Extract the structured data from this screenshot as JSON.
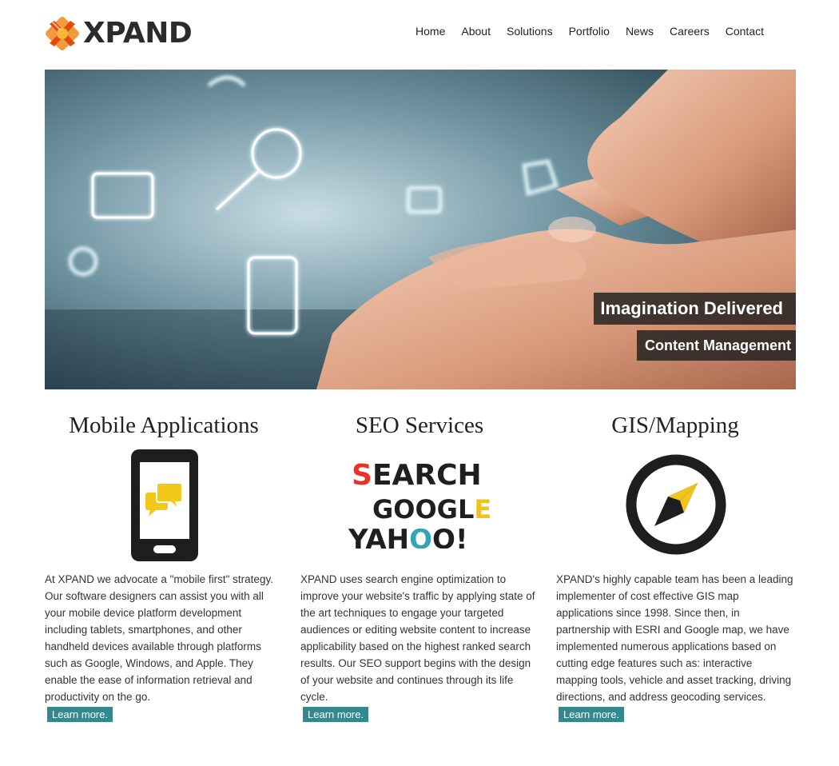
{
  "header": {
    "logo_text": "XPAND",
    "nav": [
      "Home",
      "About",
      "Solutions",
      "Portfolio",
      "News",
      "Careers",
      "Contact"
    ]
  },
  "hero": {
    "caption_main": "Imagination Delivered",
    "caption_sub": "Content Management"
  },
  "columns": [
    {
      "title": "Mobile Applications",
      "icon": "smartphone-chat-icon",
      "text": "At XPAND we advocate a \"mobile first\" strategy. Our software designers can assist you with all your mobile device platform development including tablets, smartphones, and other handheld devices available through platforms such as Google, Windows, and Apple. They enable the ease of information retrieval and productivity on the go.",
      "link": "Learn more."
    },
    {
      "title": "SEO Services",
      "icon": "search-google-yahoo-icon",
      "icon_words": [
        "SEARCH",
        "GOOGLE",
        "YAHOO!"
      ],
      "text": "XPAND uses search engine optimization to improve your website's traffic by applying state of the art techniques to engage your targeted audiences or editing website content to increase applicability based on the highest ranked search results. Our SEO support begins with the design of your website and continues through its life cycle.",
      "link": "Learn more."
    },
    {
      "title": "GIS/Mapping",
      "icon": "compass-icon",
      "text": "XPAND's highly capable team has been a leading implementer of cost effective GIS map applications since 1998. Since then, in partnership with ESRI and Google map, we have implemented numerous applications based on cutting edge features such as: interactive mapping tools, vehicle and asset tracking, driving directions, and address geocoding services.",
      "link": "Learn more."
    }
  ],
  "colors": {
    "accent": "#35898e",
    "logo_orange": "#f08a1c",
    "seo_red": "#e8332a",
    "seo_yellow": "#f2c11c",
    "seo_teal": "#35a4b8",
    "gis_yellow": "#f1c51b"
  }
}
